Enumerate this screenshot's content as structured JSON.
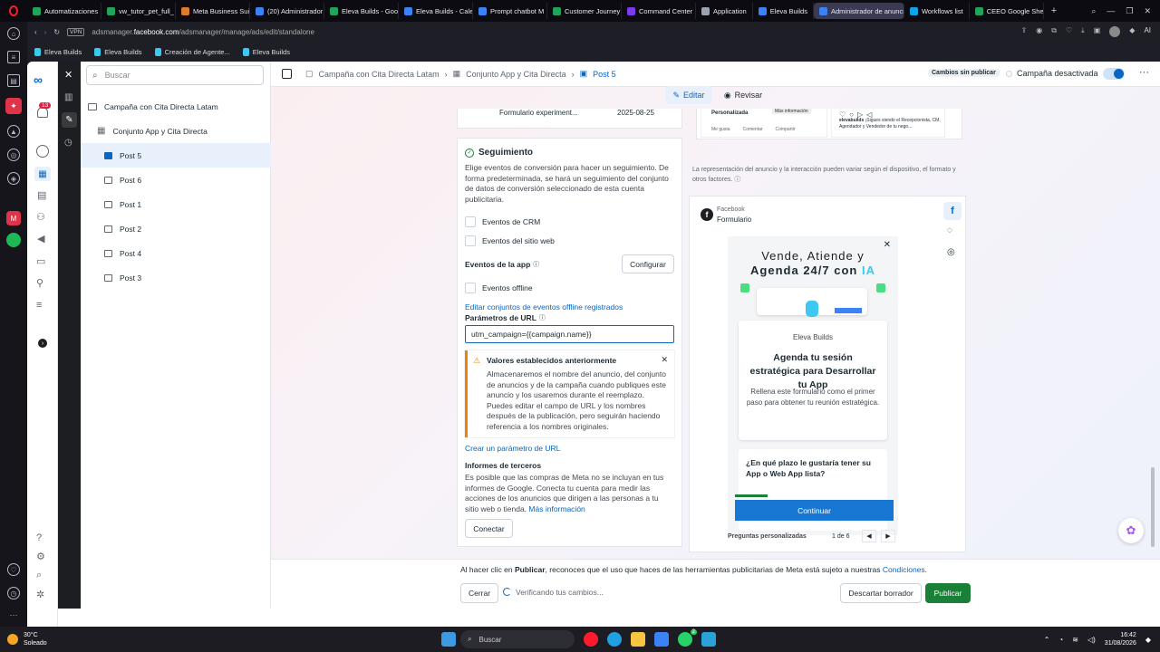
{
  "browser": {
    "tabs": [
      {
        "label": "Automatizaciones",
        "color": "#22a35a"
      },
      {
        "label": "vw_tutor_pet_full_",
        "color": "#22a35a"
      },
      {
        "label": "Meta Business Suit",
        "color": "#e07a2e"
      },
      {
        "label": "(20) Administrador",
        "color": "#3b82f6"
      },
      {
        "label": "Eleva Builds - Goo",
        "color": "#22a35a"
      },
      {
        "label": "Eleva Builds - Cale",
        "color": "#3b82f6"
      },
      {
        "label": "Prompt chatbot M",
        "color": "#3b82f6"
      },
      {
        "label": "Customer Journey",
        "color": "#22a35a"
      },
      {
        "label": "Command Center",
        "color": "#7c3aed"
      },
      {
        "label": "Application",
        "color": "#9ca3af"
      },
      {
        "label": "Eleva Builds",
        "color": "#3b82f6"
      },
      {
        "label": "Administrador de anuncio",
        "color": "#3b82f6",
        "active": true
      },
      {
        "label": "Workflows list",
        "color": "#0ea5e9"
      },
      {
        "label": "CEEO Google Shee",
        "color": "#22a35a"
      }
    ],
    "url_prefix": "adsmanager.",
    "url_domain": "facebook.com",
    "url_path": "/adsmanager/manage/ads/edit/standalone",
    "vpn_label": "VPN",
    "bookmarks": [
      "Eleva Builds",
      "Eleva Builds",
      "Creación de Agente...",
      "Eleva Builds"
    ],
    "ai_label": "AI"
  },
  "nav": {
    "notifications_count": "13"
  },
  "tree": {
    "search_placeholder": "Buscar",
    "campaign": "Campaña con Cita Directa Latam",
    "adset": "Conjunto App y Cita Directa",
    "ads": [
      "Post 5",
      "Post 6",
      "Post 1",
      "Post 2",
      "Post 4",
      "Post 3"
    ],
    "selected": "Post 5"
  },
  "topbar": {
    "breadcrumb": [
      "Campaña con Cita Directa Latam",
      "Conjunto App y Cita Directa",
      "Post 5"
    ],
    "unpublished_badge": "Cambios sin publicar",
    "campaign_status": "Campaña desactivada",
    "edit_label": "Editar",
    "review_label": "Revisar"
  },
  "form": {
    "prev_row_name": "Formulario experiment...",
    "prev_row_date": "2025-08-25",
    "tracking_title": "Seguimiento",
    "tracking_desc": "Elige eventos de conversión para hacer un seguimiento. De forma predeterminada, se hará un seguimiento del conjunto de datos de conversión seleccionado de esta cuenta publicitaria.",
    "crm_events": "Eventos de CRM",
    "web_events": "Eventos del sitio web",
    "app_events": "Eventos de la app",
    "configure": "Configurar",
    "offline_events": "Eventos offline",
    "offline_link": "Editar conjuntos de eventos offline registrados",
    "url_params_label": "Parámetros de URL",
    "url_params_value": "utm_campaign={{campaign.name}}",
    "warning_title": "Valores establecidos anteriormente",
    "warning_body": "Almacenaremos el nombre del anuncio, del conjunto de anuncios y de la campaña cuando publiques este anuncio y los usaremos durante el reemplazo. Puedes editar el campo de URL y los nombres después de la publicación, pero seguirán haciendo referencia a los nombres originales.",
    "create_param_link": "Crear un parámetro de URL",
    "third_party_title": "Informes de terceros",
    "third_party_body": "Es posible que las compras de Meta no se incluyan en tus informes de Google. Conecta tu cuenta para medir las acciones de los anuncios que dirigen a las personas a tu sitio web o tienda.",
    "more_info": "Más información",
    "connect": "Conectar"
  },
  "preview": {
    "top_label_left": "Personalizada",
    "top_label_right": "Más información",
    "like": "Me gusta",
    "comment": "Comentar",
    "share": "Compartir",
    "post_snippet_user": "elevabuilds",
    "post_snippet_text": "¡Sigues siendo el Recepcionista, CM, Agendador y Vendedor de tu nego...",
    "disclaimer": "La representación del anuncio y la interacción pueden variar según el dispositivo, el formato y otros factores.",
    "platform": "Facebook",
    "placement": "Formulario",
    "headline_line1": "Vende, Atiende y",
    "headline_line2a": "Agenda 24/7 con ",
    "headline_line2b": "IA",
    "brand": "Eleva Builds",
    "card_title": "Agenda tu sesión estratégica para Desarrollar tu App",
    "card_body": "Rellena este formulario como el primer paso para obtener tu reunión estratégica.",
    "question": "¿En qué plazo le gustaría tener su App o Web App lista?",
    "continue": "Continuar",
    "questions_label": "Preguntas personalizadas",
    "pager": "1 de 6"
  },
  "footer": {
    "notice_pre": "Al hacer clic en ",
    "notice_bold": "Publicar",
    "notice_mid": ", reconoces que el uso que haces de las herramientas publicitarias de Meta está sujeto a nuestras ",
    "notice_link": "Condiciones",
    "notice_end": ".",
    "close": "Cerrar",
    "verifying": "Verificando tus cambios...",
    "discard": "Descartar borrador",
    "publish": "Publicar"
  },
  "taskbar": {
    "temp": "30°C",
    "weather": "Soleado",
    "search": "Buscar",
    "time": "16:42",
    "date": "31/08/2026",
    "badge": "2"
  },
  "colors": {
    "accent": "#0a66c2",
    "publish": "#1a7f37",
    "warning": "#e8830c",
    "ia_highlight": "#3cc8f0"
  }
}
